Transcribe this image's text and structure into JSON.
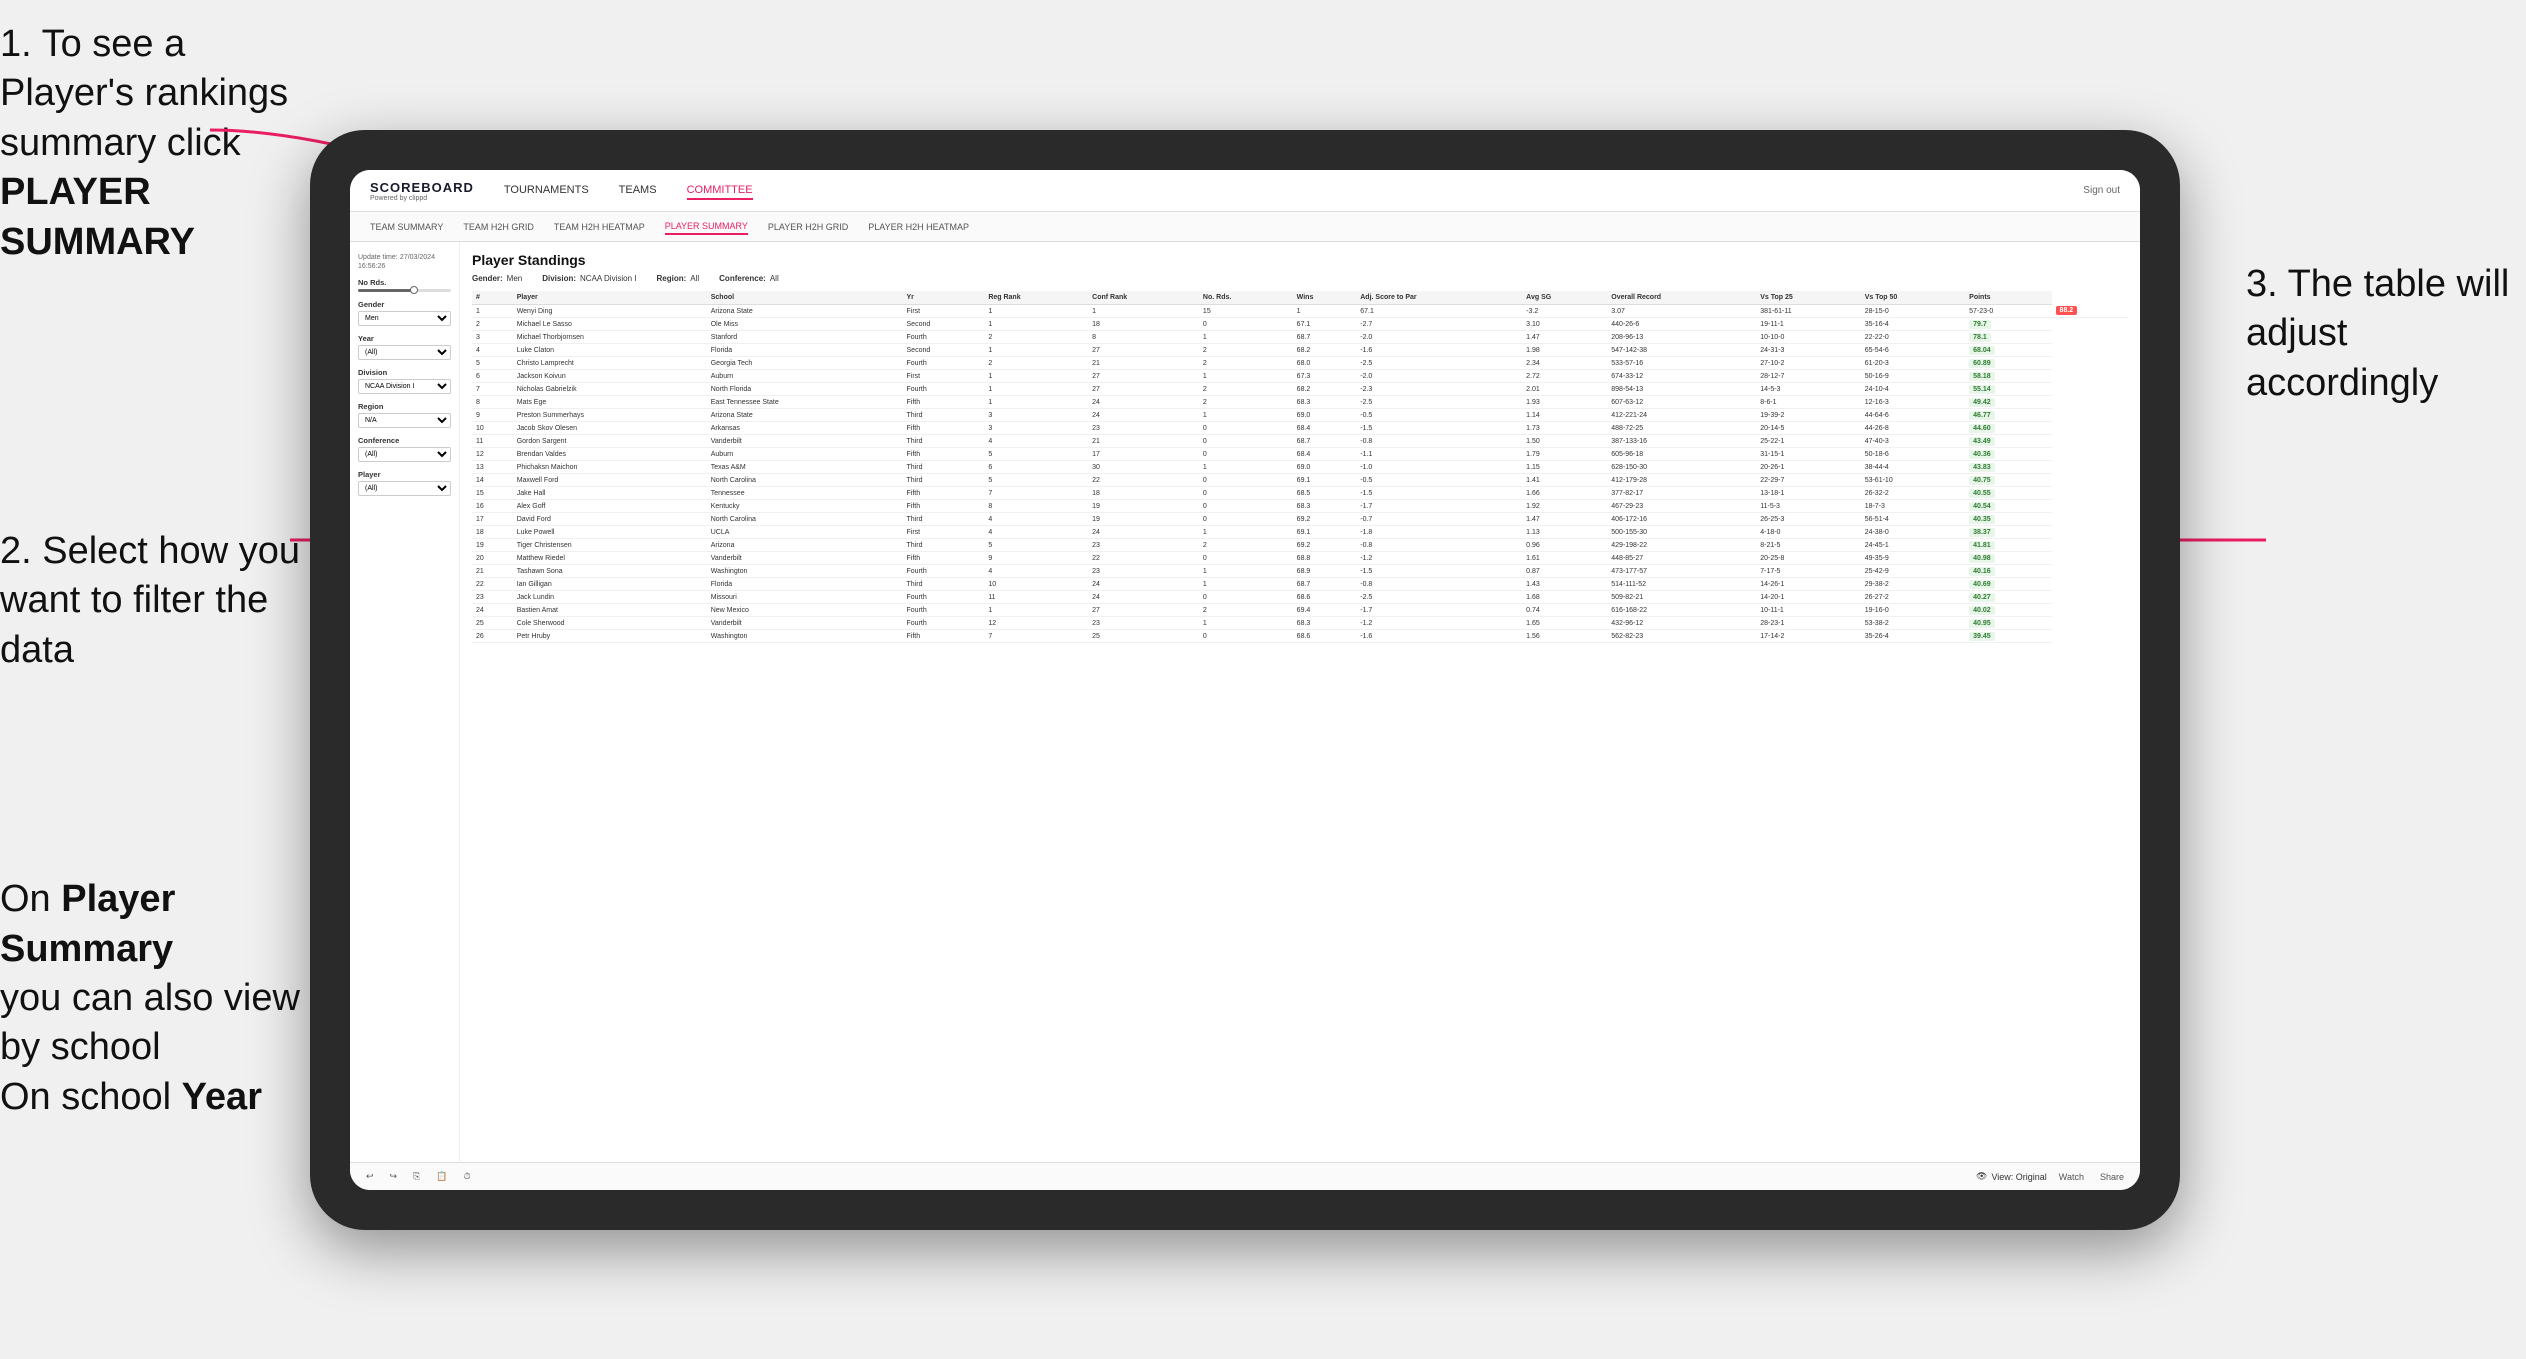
{
  "instructions": {
    "step1": "1. To see a Player's rankings summary click",
    "step1_bold": "PLAYER SUMMARY",
    "step2_title": "2. Select how you want to filter the data",
    "step3_title": "3. The table will adjust accordingly",
    "step_on_prefix": "On",
    "step_on_bold": "Player Summary",
    "step_on_suffix": "you can also view by school",
    "step_on_year_bold": "Year"
  },
  "nav": {
    "logo": "SCOREBOARD",
    "logo_sub": "Powered by clippd",
    "items": [
      "TOURNAMENTS",
      "TEAMS",
      "COMMITTEE"
    ],
    "active_item": "COMMITTEE",
    "sign_out": "Sign out"
  },
  "sub_nav": {
    "items": [
      "TEAM SUMMARY",
      "TEAM H2H GRID",
      "TEAM H2H HEATMAP",
      "PLAYER SUMMARY",
      "PLAYER H2H GRID",
      "PLAYER H2H HEATMAP"
    ],
    "active_item": "PLAYER SUMMARY"
  },
  "sidebar": {
    "update_time_label": "Update time:",
    "update_time": "27/03/2024 16:56:26",
    "no_rds_label": "No Rds.",
    "gender_label": "Gender",
    "gender_value": "Men",
    "year_label": "Year",
    "year_value": "(All)",
    "division_label": "Division",
    "division_value": "NCAA Division I",
    "region_label": "Region",
    "region_value": "N/A",
    "conference_label": "Conference",
    "conference_value": "(All)",
    "player_label": "Player",
    "player_value": "(All)"
  },
  "table": {
    "title": "Player Standings",
    "filters": {
      "gender_label": "Gender:",
      "gender_value": "Men",
      "division_label": "Division:",
      "division_value": "NCAA Division I",
      "region_label": "Region:",
      "region_value": "All",
      "conference_label": "Conference:",
      "conference_value": "All"
    },
    "columns": [
      "#",
      "Player",
      "School",
      "Yr",
      "Reg Rank",
      "Conf Rank",
      "No. Rds.",
      "Wins",
      "Adj. Score to Par",
      "Avg SG",
      "Overall Record",
      "Vs Top 25",
      "Vs Top 50",
      "Points"
    ],
    "rows": [
      [
        "1",
        "Wenyi Ding",
        "Arizona State",
        "First",
        "1",
        "1",
        "15",
        "1",
        "67.1",
        "-3.2",
        "3.07",
        "381-61-11",
        "28-15-0",
        "57-23-0",
        "88.2"
      ],
      [
        "2",
        "Michael Le Sasso",
        "Ole Miss",
        "Second",
        "1",
        "18",
        "0",
        "67.1",
        "-2.7",
        "3.10",
        "440-26-6",
        "19-11-1",
        "35-16-4",
        "79.7"
      ],
      [
        "3",
        "Michael Thorbjornsen",
        "Stanford",
        "Fourth",
        "2",
        "8",
        "1",
        "68.7",
        "-2.0",
        "1.47",
        "208-96-13",
        "10-10-0",
        "22-22-0",
        "78.1"
      ],
      [
        "4",
        "Luke Claton",
        "Florida",
        "Second",
        "1",
        "27",
        "2",
        "68.2",
        "-1.6",
        "1.98",
        "547-142-38",
        "24-31-3",
        "65-54-6",
        "68.04"
      ],
      [
        "5",
        "Christo Lamprecht",
        "Georgia Tech",
        "Fourth",
        "2",
        "21",
        "2",
        "68.0",
        "-2.5",
        "2.34",
        "533-57-16",
        "27-10-2",
        "61-20-3",
        "60.89"
      ],
      [
        "6",
        "Jackson Koivun",
        "Auburn",
        "First",
        "1",
        "27",
        "1",
        "67.3",
        "-2.0",
        "2.72",
        "674-33-12",
        "28-12-7",
        "50-16-9",
        "58.18"
      ],
      [
        "7",
        "Nicholas Gabrielzik",
        "North Florida",
        "Fourth",
        "1",
        "27",
        "2",
        "68.2",
        "-2.3",
        "2.01",
        "898-54-13",
        "14-5-3",
        "24-10-4",
        "55.14"
      ],
      [
        "8",
        "Mats Ege",
        "East Tennessee State",
        "Fifth",
        "1",
        "24",
        "2",
        "68.3",
        "-2.5",
        "1.93",
        "607-63-12",
        "8-6-1",
        "12-16-3",
        "49.42"
      ],
      [
        "9",
        "Preston Summerhays",
        "Arizona State",
        "Third",
        "3",
        "24",
        "1",
        "69.0",
        "-0.5",
        "1.14",
        "412-221-24",
        "19-39-2",
        "44-64-6",
        "46.77"
      ],
      [
        "10",
        "Jacob Skov Olesen",
        "Arkansas",
        "Fifth",
        "3",
        "23",
        "0",
        "68.4",
        "-1.5",
        "1.73",
        "488-72-25",
        "20-14-5",
        "44-26-8",
        "44.60"
      ],
      [
        "11",
        "Gordon Sargent",
        "Vanderbilt",
        "Third",
        "4",
        "21",
        "0",
        "68.7",
        "-0.8",
        "1.50",
        "387-133-16",
        "25-22-1",
        "47-40-3",
        "43.49"
      ],
      [
        "12",
        "Brendan Valdes",
        "Auburn",
        "Fifth",
        "5",
        "17",
        "0",
        "68.4",
        "-1.1",
        "1.79",
        "605-96-18",
        "31-15-1",
        "50-18-6",
        "40.36"
      ],
      [
        "13",
        "Phichaksn Maichon",
        "Texas A&M",
        "Third",
        "6",
        "30",
        "1",
        "69.0",
        "-1.0",
        "1.15",
        "628-150-30",
        "20-26-1",
        "38-44-4",
        "43.83"
      ],
      [
        "14",
        "Maxwell Ford",
        "North Carolina",
        "Third",
        "5",
        "22",
        "0",
        "69.1",
        "-0.5",
        "1.41",
        "412-179-28",
        "22-29-7",
        "53-61-10",
        "40.75"
      ],
      [
        "15",
        "Jake Hall",
        "Tennessee",
        "Fifth",
        "7",
        "18",
        "0",
        "68.5",
        "-1.5",
        "1.66",
        "377-82-17",
        "13-18-1",
        "26-32-2",
        "40.55"
      ],
      [
        "16",
        "Alex Goff",
        "Kentucky",
        "Fifth",
        "8",
        "19",
        "0",
        "68.3",
        "-1.7",
        "1.92",
        "467-29-23",
        "11-5-3",
        "18-7-3",
        "40.54"
      ],
      [
        "17",
        "David Ford",
        "North Carolina",
        "Third",
        "4",
        "19",
        "0",
        "69.2",
        "-0.7",
        "1.47",
        "406-172-16",
        "26-25-3",
        "56-51-4",
        "40.35"
      ],
      [
        "18",
        "Luke Powell",
        "UCLA",
        "First",
        "4",
        "24",
        "1",
        "69.1",
        "-1.8",
        "1.13",
        "500-155-30",
        "4-18-0",
        "24-38-0",
        "38.37"
      ],
      [
        "19",
        "Tiger Christensen",
        "Arizona",
        "Third",
        "5",
        "23",
        "2",
        "69.2",
        "-0.8",
        "0.96",
        "429-198-22",
        "8-21-5",
        "24-45-1",
        "41.81"
      ],
      [
        "20",
        "Matthew Riedel",
        "Vanderbilt",
        "Fifth",
        "9",
        "22",
        "0",
        "68.8",
        "-1.2",
        "1.61",
        "448-85-27",
        "20-25-8",
        "49-35-9",
        "40.98"
      ],
      [
        "21",
        "Tashawn Sona",
        "Washington",
        "Fourth",
        "4",
        "23",
        "1",
        "68.9",
        "-1.5",
        "0.87",
        "473-177-57",
        "7-17-5",
        "25-42-9",
        "40.16"
      ],
      [
        "22",
        "Ian Gilligan",
        "Florida",
        "Third",
        "10",
        "24",
        "1",
        "68.7",
        "-0.8",
        "1.43",
        "514-111-52",
        "14-26-1",
        "29-38-2",
        "40.69"
      ],
      [
        "23",
        "Jack Lundin",
        "Missouri",
        "Fourth",
        "11",
        "24",
        "0",
        "68.6",
        "-2.5",
        "1.68",
        "509-82-21",
        "14-20-1",
        "26-27-2",
        "40.27"
      ],
      [
        "24",
        "Bastien Amat",
        "New Mexico",
        "Fourth",
        "1",
        "27",
        "2",
        "69.4",
        "-1.7",
        "0.74",
        "616-168-22",
        "10-11-1",
        "19-16-0",
        "40.02"
      ],
      [
        "25",
        "Cole Sherwood",
        "Vanderbilt",
        "Fourth",
        "12",
        "23",
        "1",
        "68.3",
        "-1.2",
        "1.65",
        "432-96-12",
        "28-23-1",
        "53-38-2",
        "40.95"
      ],
      [
        "26",
        "Petr Hruby",
        "Washington",
        "Fifth",
        "7",
        "25",
        "0",
        "68.6",
        "-1.6",
        "1.56",
        "562-82-23",
        "17-14-2",
        "35-26-4",
        "39.45"
      ]
    ]
  },
  "toolbar": {
    "undo": "↩",
    "redo": "↪",
    "view_label": "View: Original",
    "watch_label": "Watch",
    "share_label": "Share"
  }
}
